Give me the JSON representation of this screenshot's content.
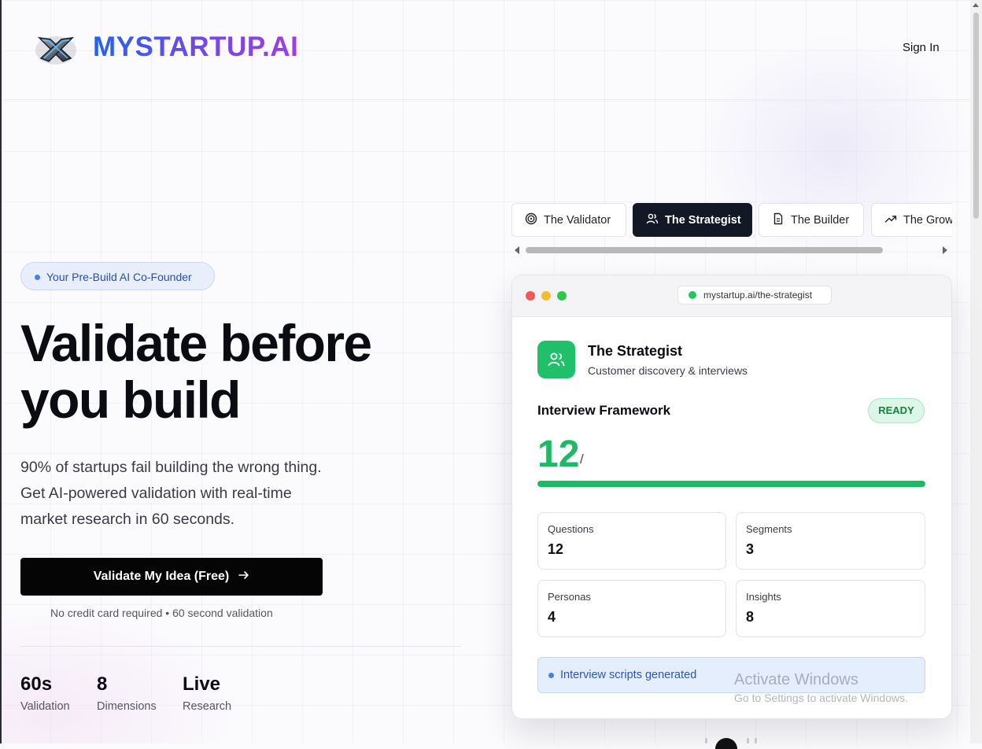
{
  "brand": {
    "name": "MYSTARTUP.AI",
    "logo_icon": "crossed-links-logo"
  },
  "header": {
    "signin_label": "Sign In"
  },
  "hero": {
    "badge": "Your Pre-Build AI Co-Founder",
    "headline_line1": "Validate before",
    "headline_line2": "you build",
    "subtext_line1": "90% of startups fail building the wrong thing.",
    "subtext_line2": "Get AI-powered validation with real-time",
    "subtext_line3": "market research in 60 seconds.",
    "cta_label": "Validate My Idea (Free)",
    "cta_icon": "arrow-right-icon",
    "cta_note": "No credit card required • 60 second validation",
    "stats": [
      {
        "value": "60s",
        "label": "Validation"
      },
      {
        "value": "8",
        "label": "Dimensions"
      },
      {
        "value": "Live",
        "label": "Research"
      }
    ]
  },
  "tabs": [
    {
      "label": "The Validator",
      "icon": "target-icon",
      "active": false
    },
    {
      "label": "The Strategist",
      "icon": "users-icon",
      "active": true
    },
    {
      "label": "The Builder",
      "icon": "document-icon",
      "active": false
    },
    {
      "label": "The Growth",
      "icon": "trending-up-icon",
      "active": false
    }
  ],
  "preview": {
    "url": "mystartup.ai/the-strategist",
    "agent_name": "The Strategist",
    "agent_desc": "Customer discovery & interviews",
    "framework_title": "Interview Framework",
    "status": "READY",
    "big_number": "12",
    "big_suffix": "/",
    "progress_fraction": 1.0,
    "metrics": [
      {
        "label": "Questions",
        "value": "12"
      },
      {
        "label": "Segments",
        "value": "3"
      },
      {
        "label": "Personas",
        "value": "4"
      },
      {
        "label": "Insights",
        "value": "8"
      }
    ],
    "notice": "Interview scripts generated"
  },
  "watermark": {
    "line1": "Activate Windows",
    "line2": "Go to Settings to activate Windows."
  },
  "colors": {
    "accent_green": "#1db965",
    "accent_blue": "#2563eb",
    "brand_purple": "#a43ce0",
    "dark": "#121826"
  }
}
